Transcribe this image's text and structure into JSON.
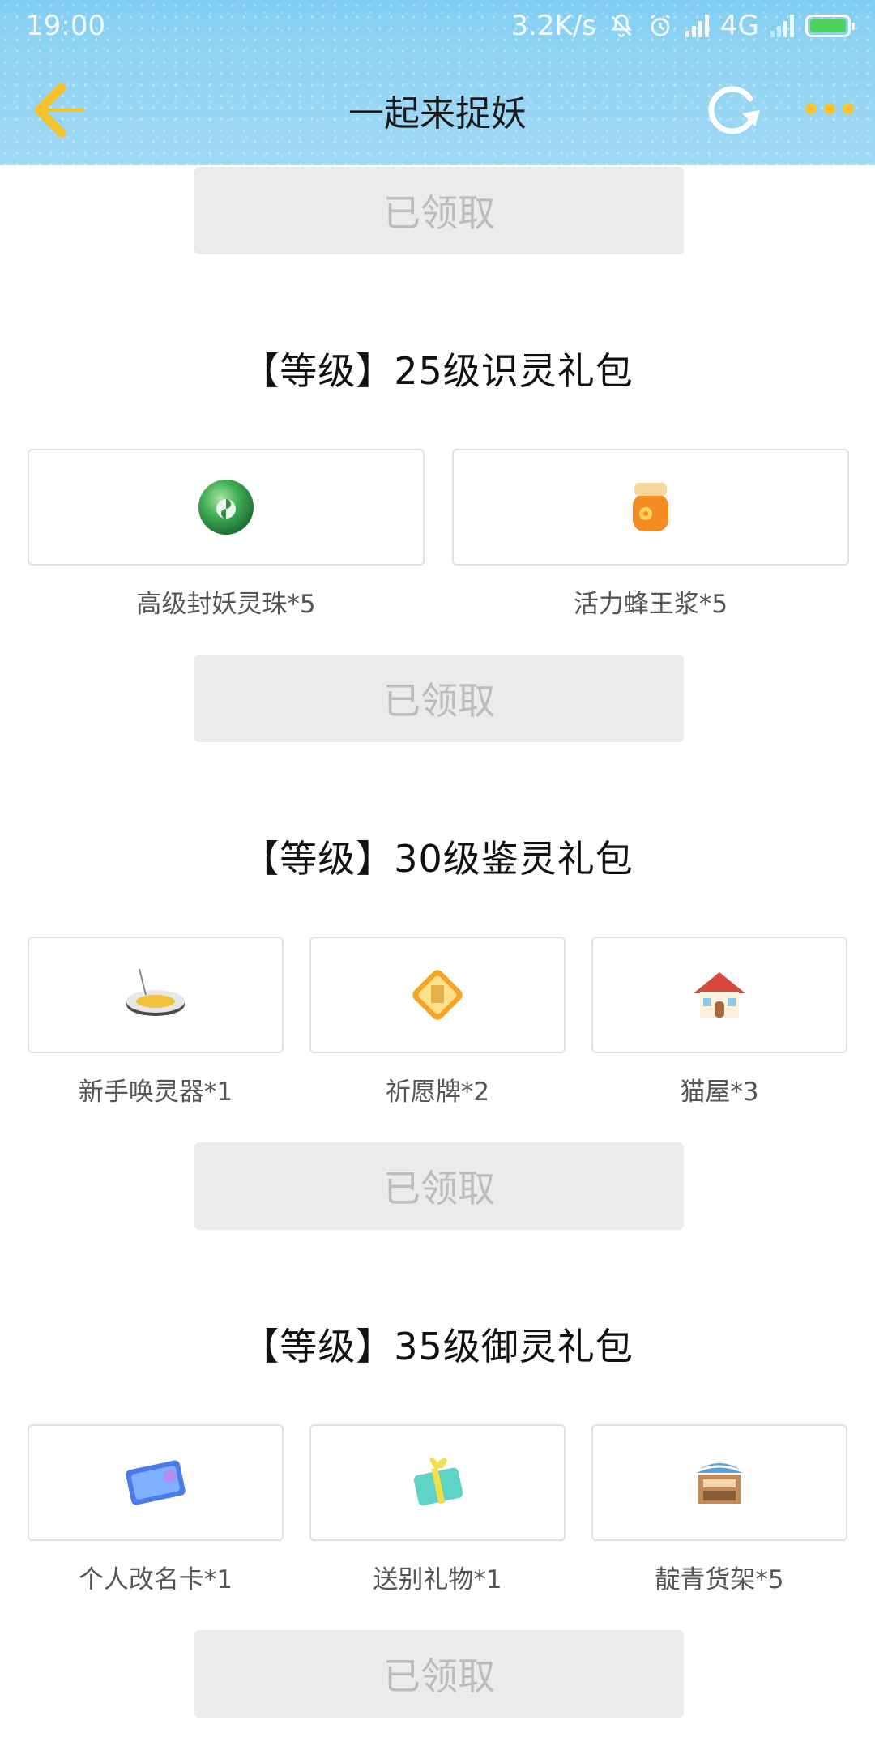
{
  "status_bar": {
    "time": "19:00",
    "net_speed": "3.2K/s",
    "network": "4G"
  },
  "nav": {
    "title": "一起来捉妖",
    "back_icon": "chevron-left-icon",
    "refresh_icon": "refresh-icon",
    "more_icon": "more-dots-icon"
  },
  "claim_label": "已领取",
  "packs": [
    {
      "title": "【等级】25级识灵礼包",
      "items": [
        {
          "label": "高级封妖灵珠*5",
          "icon": "green-orb-icon"
        },
        {
          "label": "活力蜂王浆*5",
          "icon": "honey-jar-icon"
        }
      ],
      "claim_label": "已领取"
    },
    {
      "title": "【等级】30级鉴灵礼包",
      "items": [
        {
          "label": "新手唤灵器*1",
          "icon": "summoner-device-icon"
        },
        {
          "label": "祈愿牌*2",
          "icon": "wish-plaque-icon"
        },
        {
          "label": "猫屋*3",
          "icon": "cat-house-icon"
        }
      ],
      "claim_label": "已领取"
    },
    {
      "title": "【等级】35级御灵礼包",
      "items": [
        {
          "label": "个人改名卡*1",
          "icon": "rename-card-icon"
        },
        {
          "label": "送别礼物*1",
          "icon": "gift-box-icon"
        },
        {
          "label": "靛青货架*5",
          "icon": "market-stall-icon"
        }
      ],
      "claim_label": "已领取"
    }
  ],
  "colors": {
    "header_bg": "#8fd3f3",
    "accent_gold": "#f7c42f",
    "button_bg": "#eaebed",
    "button_text": "#bcbcbc"
  }
}
